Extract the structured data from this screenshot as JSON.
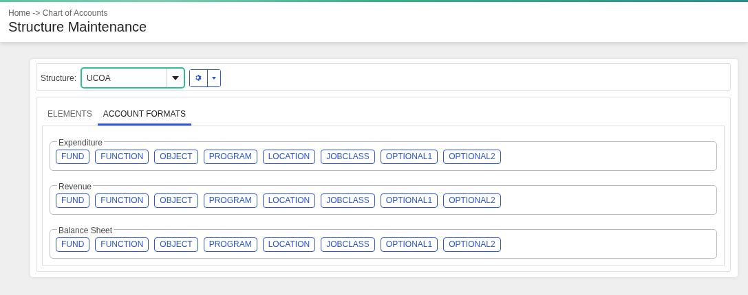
{
  "breadcrumb": "Home -> Chart of Accounts",
  "page_title": "Structure Maintenance",
  "structure": {
    "label": "Structure:",
    "value": "UCOA"
  },
  "tabs": [
    {
      "label": "ELEMENTS",
      "selected": false
    },
    {
      "label": "ACCOUNT FORMATS",
      "selected": true
    }
  ],
  "formats": [
    {
      "legend": "Expenditure",
      "segments": [
        "FUND",
        "FUNCTION",
        "OBJECT",
        "PROGRAM",
        "LOCATION",
        "JOBCLASS",
        "OPTIONAL1",
        "OPTIONAL2"
      ]
    },
    {
      "legend": "Revenue",
      "segments": [
        "FUND",
        "FUNCTION",
        "OBJECT",
        "PROGRAM",
        "LOCATION",
        "JOBCLASS",
        "OPTIONAL1",
        "OPTIONAL2"
      ]
    },
    {
      "legend": "Balance Sheet",
      "segments": [
        "FUND",
        "FUNCTION",
        "OBJECT",
        "PROGRAM",
        "LOCATION",
        "JOBCLASS",
        "OPTIONAL1",
        "OPTIONAL2"
      ]
    }
  ]
}
